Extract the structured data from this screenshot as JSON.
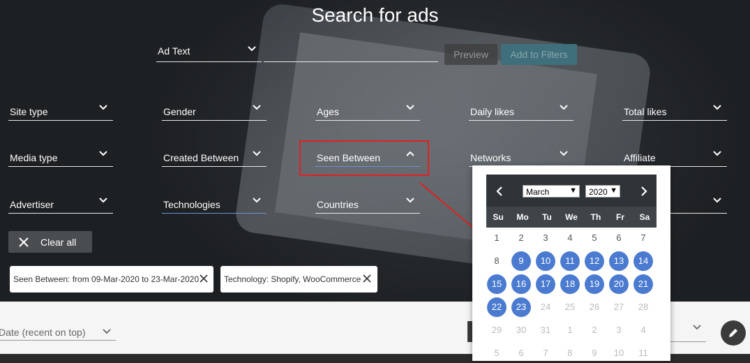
{
  "page": {
    "title": "Search for ads"
  },
  "ad_text": {
    "label": "Ad Text"
  },
  "buttons": {
    "preview": "Preview",
    "add_to_filters": "Add to Filters",
    "clear_all": "Clear all"
  },
  "filters": [
    {
      "label": "Site type"
    },
    {
      "label": "Gender"
    },
    {
      "label": "Ages"
    },
    {
      "label": "Daily likes"
    },
    {
      "label": "Total likes"
    },
    {
      "label": "Media type"
    },
    {
      "label": "Created Between"
    },
    {
      "label": "Seen Between"
    },
    {
      "label": "Networks"
    },
    {
      "label": "Affiliate"
    },
    {
      "label": "Advertiser"
    },
    {
      "label": "Technologies"
    },
    {
      "label": "Countries"
    },
    {
      "label": ""
    },
    {
      "label": ""
    }
  ],
  "chips": [
    {
      "text": "Seen Between: from 09-Mar-2020 to 23-Mar-2020"
    },
    {
      "text": "Technology: Shopify, WooCommerce"
    }
  ],
  "sort": {
    "value": "Date (recent on top)"
  },
  "calendar": {
    "month": "March",
    "year": "2020",
    "weekdays": [
      "Su",
      "Mo",
      "Tu",
      "We",
      "Th",
      "Fr",
      "Sa"
    ],
    "weeks": [
      [
        "1",
        "2",
        "3",
        "4",
        "5",
        "6",
        "7"
      ],
      [
        "8",
        "9",
        "10",
        "11",
        "12",
        "13",
        "14"
      ],
      [
        "15",
        "16",
        "17",
        "18",
        "19",
        "20",
        "21"
      ],
      [
        "22",
        "23",
        "24",
        "25",
        "26",
        "27",
        "28"
      ],
      [
        "29",
        "30",
        "31",
        "1",
        "2",
        "3",
        "4"
      ],
      [
        "5",
        "6",
        "7",
        "8",
        "9",
        "10",
        "11"
      ]
    ],
    "selected_range": [
      "9",
      "23"
    ]
  },
  "colors": {
    "accent": "#4a7bd0",
    "highlight_box": "#e02020"
  }
}
